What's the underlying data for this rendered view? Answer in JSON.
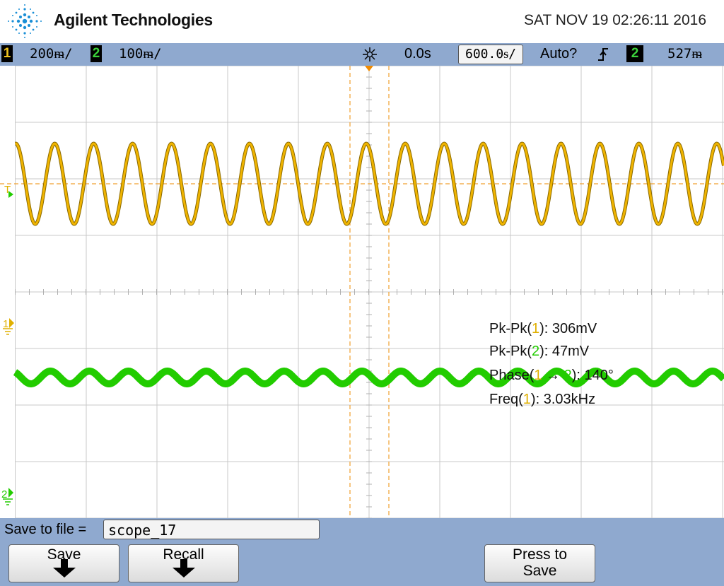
{
  "header": {
    "brand": "Agilent Technologies",
    "datetime": "SAT NOV 19 02:26:11 2016"
  },
  "status": {
    "ch1_number": "1",
    "ch1_scale": "200ᵯ/",
    "ch2_number": "2",
    "ch2_scale": "100ᵯ/",
    "delay": "0.0s",
    "timebase": "600.0ᵴ/",
    "trigger_mode": "Auto?",
    "trigger_source": "2",
    "trigger_level": "527ᵯ"
  },
  "markers": {
    "trigger_level": "T",
    "ch1_ground": "1",
    "ch2_ground": "2"
  },
  "measurements": {
    "pkpk1_prefix": "Pk-Pk(",
    "pkpk1_ch": "1",
    "pkpk1_value": "): 306mV",
    "pkpk2_prefix": "Pk-Pk(",
    "pkpk2_ch": "2",
    "pkpk2_value": "): 47mV",
    "phase_prefix": "Phase(",
    "phase_ch1": "1",
    "phase_arrow": " → ",
    "phase_ch2": "2",
    "phase_value": "): 140°",
    "freq_prefix": "Freq(",
    "freq_ch": "1",
    "freq_value": "): 3.03kHz"
  },
  "menu": {
    "save_to_file_label": "Save to file =",
    "filename": "scope_17",
    "save_button": "Save",
    "recall_button": "Recall",
    "press_to_save_line1": "Press to",
    "press_to_save_line2": "Save"
  },
  "colors": {
    "ch1": "#f0b400",
    "ch2": "#22cc00",
    "grid": "#c8c8c8",
    "cursor": "#f0a030",
    "menu_bg": "#8fa9cf"
  },
  "waveforms": {
    "ch1_cycles_across_screen": 18.2,
    "ch2_cycles_across_screen": 18.2
  }
}
